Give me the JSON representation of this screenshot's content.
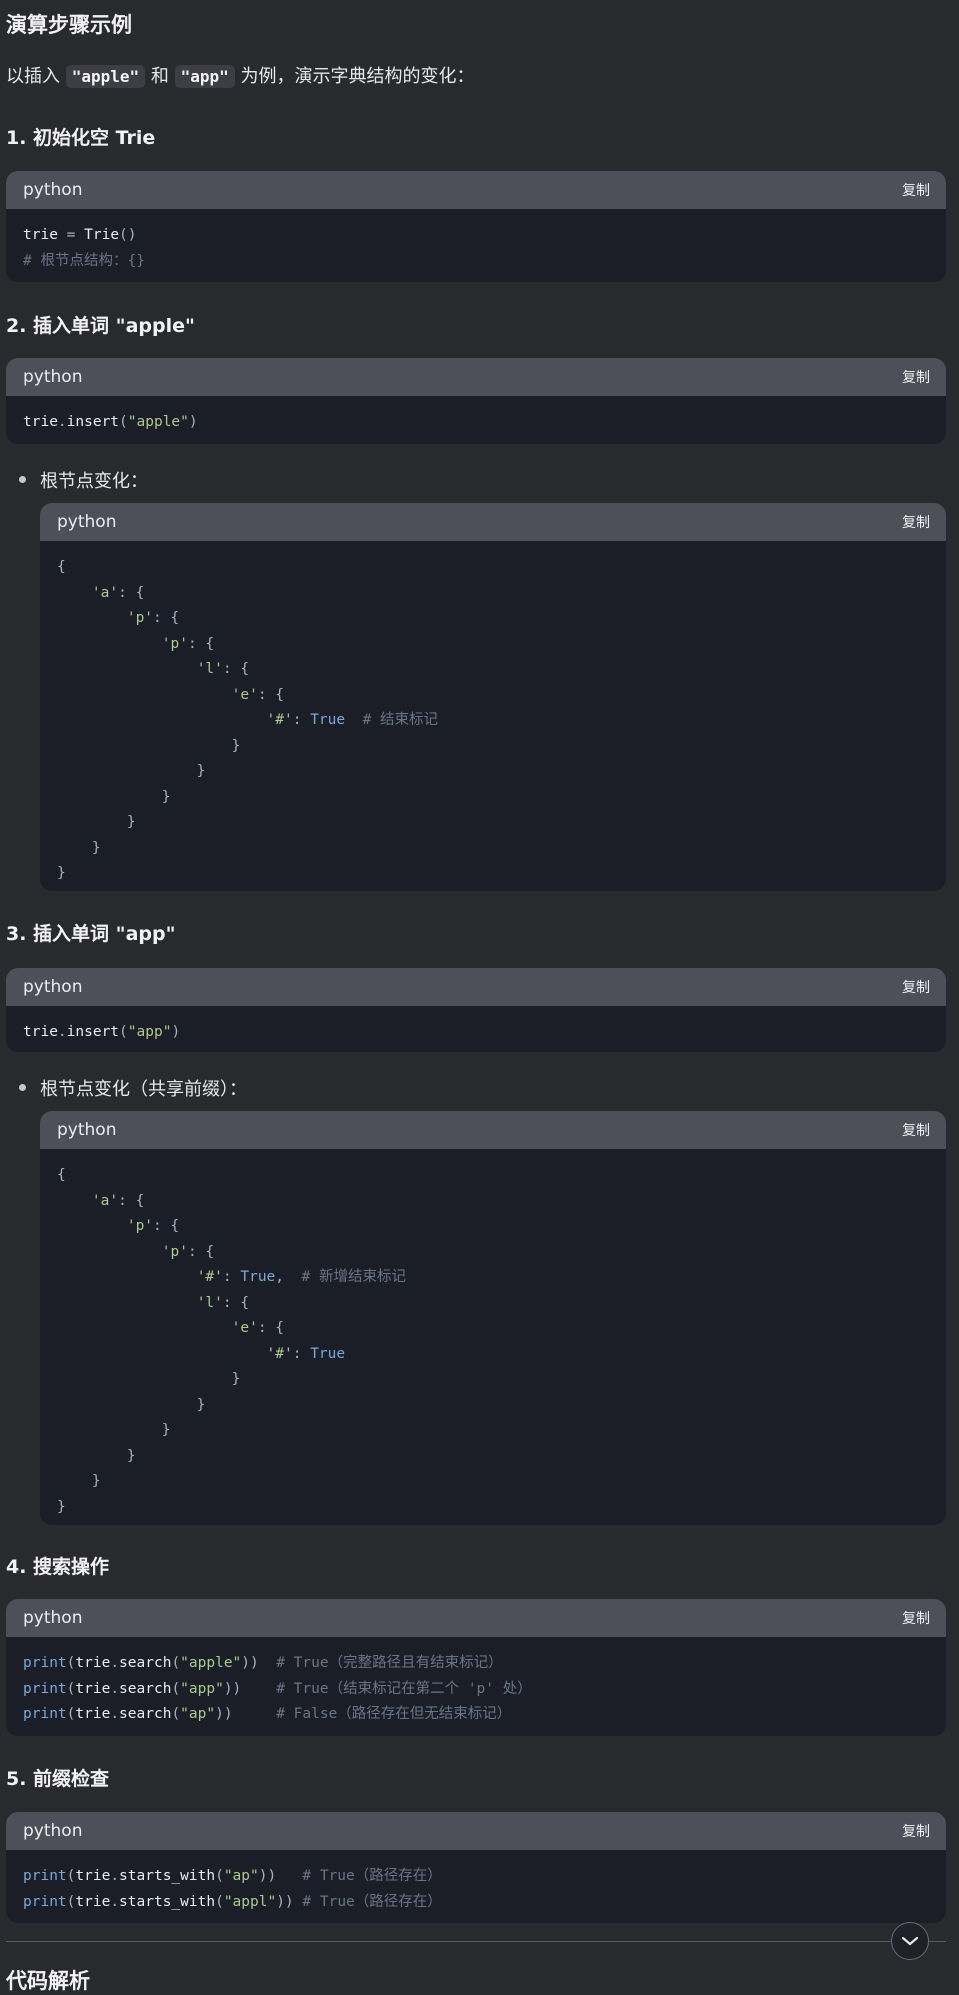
{
  "title": "演算步骤示例",
  "intro": {
    "prefix": "以插入 ",
    "code1": "\"apple\"",
    "mid": " 和 ",
    "code2": "\"app\"",
    "suffix": " 为例，演示字典结构的变化："
  },
  "steps": {
    "s1": "1. 初始化空 Trie",
    "s2": "2. 插入单词 \"apple\"",
    "s3": "3. 插入单词 \"app\"",
    "s4": "4. 搜索操作",
    "s5": "5. 前缀检查"
  },
  "bullets": {
    "b1": "根节点变化：",
    "b2": "根节点变化（共享前缀）："
  },
  "code_lang": "python",
  "copy_label": "复制",
  "code": {
    "c1": [
      [
        [
          "id",
          "trie"
        ],
        [
          "pn",
          " = "
        ],
        [
          "id",
          "Trie"
        ],
        [
          "pn",
          "()"
        ]
      ],
      [
        [
          "cm",
          "# 根节点结构：{}"
        ]
      ]
    ],
    "c2": [
      [
        [
          "id",
          "trie"
        ],
        [
          "pn",
          "."
        ],
        [
          "id",
          "insert"
        ],
        [
          "pn",
          "("
        ],
        [
          "str",
          "\"apple\""
        ],
        [
          "pn",
          ")"
        ]
      ]
    ],
    "c3": [
      [
        [
          "pn",
          "{"
        ]
      ],
      [
        [
          "pn",
          "    "
        ],
        [
          "str",
          "'a'"
        ],
        [
          "pn",
          ": {"
        ]
      ],
      [
        [
          "pn",
          "        "
        ],
        [
          "str",
          "'p'"
        ],
        [
          "pn",
          ": {"
        ]
      ],
      [
        [
          "pn",
          "            "
        ],
        [
          "str",
          "'p'"
        ],
        [
          "pn",
          ": {"
        ]
      ],
      [
        [
          "pn",
          "                "
        ],
        [
          "str",
          "'l'"
        ],
        [
          "pn",
          ": {"
        ]
      ],
      [
        [
          "pn",
          "                    "
        ],
        [
          "str",
          "'e'"
        ],
        [
          "pn",
          ": {"
        ]
      ],
      [
        [
          "pn",
          "                        "
        ],
        [
          "str",
          "'#'"
        ],
        [
          "pn",
          ": "
        ],
        [
          "kw",
          "True"
        ],
        [
          "pn",
          "  "
        ],
        [
          "cm",
          "# 结束标记"
        ]
      ],
      [
        [
          "pn",
          "                    }"
        ]
      ],
      [
        [
          "pn",
          "                }"
        ]
      ],
      [
        [
          "pn",
          "            }"
        ]
      ],
      [
        [
          "pn",
          "        }"
        ]
      ],
      [
        [
          "pn",
          "    }"
        ]
      ],
      [
        [
          "pn",
          "}"
        ]
      ]
    ],
    "c4": [
      [
        [
          "id",
          "trie"
        ],
        [
          "pn",
          "."
        ],
        [
          "id",
          "insert"
        ],
        [
          "pn",
          "("
        ],
        [
          "str",
          "\"app\""
        ],
        [
          "pn",
          ")"
        ]
      ]
    ],
    "c5": [
      [
        [
          "pn",
          "{"
        ]
      ],
      [
        [
          "pn",
          "    "
        ],
        [
          "str",
          "'a'"
        ],
        [
          "pn",
          ": {"
        ]
      ],
      [
        [
          "pn",
          "        "
        ],
        [
          "str",
          "'p'"
        ],
        [
          "pn",
          ": {"
        ]
      ],
      [
        [
          "pn",
          "            "
        ],
        [
          "str",
          "'p'"
        ],
        [
          "pn",
          ": {"
        ]
      ],
      [
        [
          "pn",
          "                "
        ],
        [
          "str",
          "'#'"
        ],
        [
          "pn",
          ": "
        ],
        [
          "kw",
          "True"
        ],
        [
          "pn",
          ",  "
        ],
        [
          "cm",
          "# 新增结束标记"
        ]
      ],
      [
        [
          "pn",
          "                "
        ],
        [
          "str",
          "'l'"
        ],
        [
          "pn",
          ": {"
        ]
      ],
      [
        [
          "pn",
          "                    "
        ],
        [
          "str",
          "'e'"
        ],
        [
          "pn",
          ": {"
        ]
      ],
      [
        [
          "pn",
          "                        "
        ],
        [
          "str",
          "'#'"
        ],
        [
          "pn",
          ": "
        ],
        [
          "kw",
          "True"
        ]
      ],
      [
        [
          "pn",
          "                    }"
        ]
      ],
      [
        [
          "pn",
          "                }"
        ]
      ],
      [
        [
          "pn",
          "            }"
        ]
      ],
      [
        [
          "pn",
          "        }"
        ]
      ],
      [
        [
          "pn",
          "    }"
        ]
      ],
      [
        [
          "pn",
          "}"
        ]
      ]
    ],
    "c6": [
      [
        [
          "kw",
          "print"
        ],
        [
          "pn",
          "("
        ],
        [
          "id",
          "trie"
        ],
        [
          "pn",
          "."
        ],
        [
          "id",
          "search"
        ],
        [
          "pn",
          "("
        ],
        [
          "str",
          "\"apple\""
        ],
        [
          "pn",
          "))  "
        ],
        [
          "cm",
          "# True（完整路径且有结束标记）"
        ]
      ],
      [
        [
          "kw",
          "print"
        ],
        [
          "pn",
          "("
        ],
        [
          "id",
          "trie"
        ],
        [
          "pn",
          "."
        ],
        [
          "id",
          "search"
        ],
        [
          "pn",
          "("
        ],
        [
          "str",
          "\"app\""
        ],
        [
          "pn",
          "))    "
        ],
        [
          "cm",
          "# True（结束标记在第二个 'p' 处）"
        ]
      ],
      [
        [
          "kw",
          "print"
        ],
        [
          "pn",
          "("
        ],
        [
          "id",
          "trie"
        ],
        [
          "pn",
          "."
        ],
        [
          "id",
          "search"
        ],
        [
          "pn",
          "("
        ],
        [
          "str",
          "\"ap\""
        ],
        [
          "pn",
          "))     "
        ],
        [
          "cm",
          "# False（路径存在但无结束标记）"
        ]
      ]
    ],
    "c7": [
      [
        [
          "kw",
          "print"
        ],
        [
          "pn",
          "("
        ],
        [
          "id",
          "trie"
        ],
        [
          "pn",
          "."
        ],
        [
          "id",
          "starts_with"
        ],
        [
          "pn",
          "("
        ],
        [
          "str",
          "\"ap\""
        ],
        [
          "pn",
          "))   "
        ],
        [
          "cm",
          "# True（路径存在）"
        ]
      ],
      [
        [
          "kw",
          "print"
        ],
        [
          "pn",
          "("
        ],
        [
          "id",
          "trie"
        ],
        [
          "pn",
          "."
        ],
        [
          "id",
          "starts_with"
        ],
        [
          "pn",
          "("
        ],
        [
          "str",
          "\"appl\""
        ],
        [
          "pn",
          ")) "
        ],
        [
          "cm",
          "# True（路径存在）"
        ]
      ]
    ]
  },
  "next_section_partial": "代码解析",
  "icons": {
    "scroll_down": "chevron-down-icon"
  }
}
